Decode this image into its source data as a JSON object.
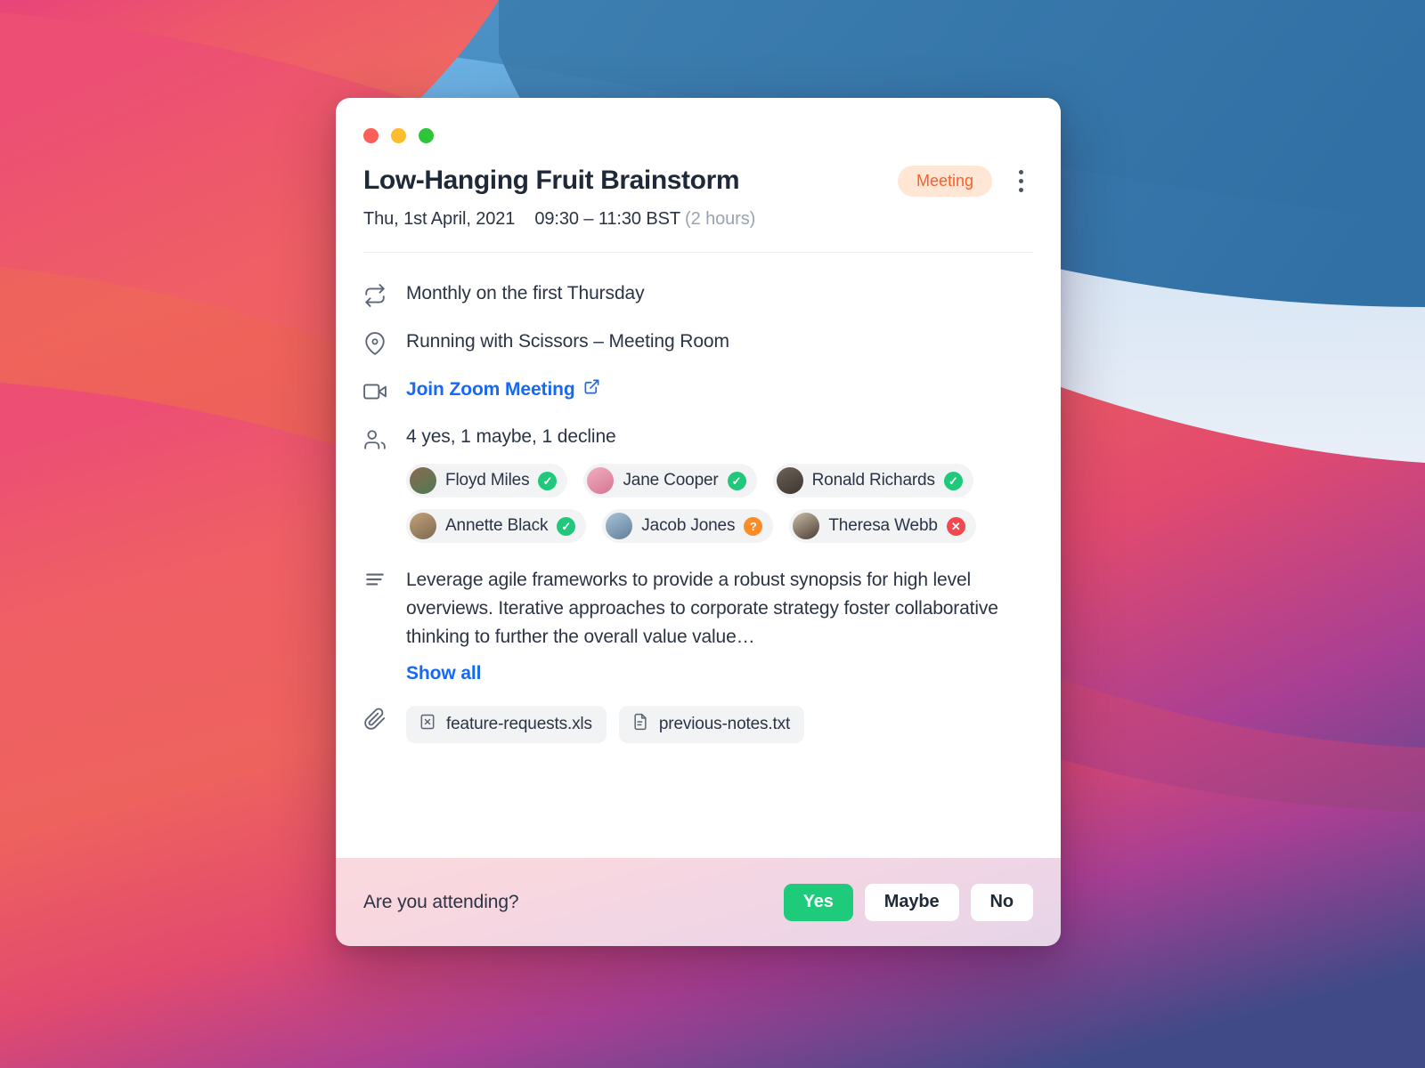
{
  "window": {
    "traffic_lights": [
      {
        "name": "close",
        "color": "#fc5f57"
      },
      {
        "name": "minimize",
        "color": "#fcbc2e"
      },
      {
        "name": "zoom",
        "color": "#2fc53a"
      }
    ]
  },
  "header": {
    "title": "Low-Hanging Fruit Brainstorm",
    "badge": "Meeting",
    "badge_color": "#fa5e2b",
    "badge_bg": "#ffe6d5",
    "date": "Thu, 1st April, 2021",
    "time": "09:30 – 11:30 BST",
    "duration": "(2 hours)"
  },
  "details": {
    "recurrence": "Monthly on the first Thursday",
    "location": "Running with Scissors – Meeting Room",
    "conference_link": "Join Zoom Meeting"
  },
  "attendees": {
    "summary": "4 yes, 1 maybe, 1 decline",
    "people": [
      {
        "name": "Floyd Miles",
        "status": "yes",
        "status_glyph": "✓",
        "avatar_a": "#8a6a52",
        "avatar_b": "#4f7a52"
      },
      {
        "name": "Jane Cooper",
        "status": "yes",
        "status_glyph": "✓",
        "avatar_a": "#f2aec4",
        "avatar_b": "#d4768f"
      },
      {
        "name": "Ronald Richards",
        "status": "yes",
        "status_glyph": "✓",
        "avatar_a": "#6f6357",
        "avatar_b": "#3a3530"
      },
      {
        "name": "Annette Black",
        "status": "yes",
        "status_glyph": "✓",
        "avatar_a": "#c2a07a",
        "avatar_b": "#7d6a4f"
      },
      {
        "name": "Jacob Jones",
        "status": "maybe",
        "status_glyph": "?",
        "avatar_a": "#a9c3d6",
        "avatar_b": "#5f7f99"
      },
      {
        "name": "Theresa Webb",
        "status": "no",
        "status_glyph": "✕",
        "avatar_a": "#cbbda8",
        "avatar_b": "#4a3c33"
      }
    ]
  },
  "description": {
    "text": "Leverage agile frameworks to provide a robust synopsis for high level overviews. Iterative approaches to corporate strategy foster collaborative thinking to further the overall value value…",
    "show_all": "Show all"
  },
  "attachments": [
    {
      "filename": "feature-requests.xls",
      "kind": "spreadsheet"
    },
    {
      "filename": "previous-notes.txt",
      "kind": "text"
    }
  ],
  "footer": {
    "question": "Are you attending?",
    "buttons": [
      {
        "label": "Yes",
        "primary": true
      },
      {
        "label": "Maybe",
        "primary": false
      },
      {
        "label": "No",
        "primary": false
      }
    ]
  }
}
